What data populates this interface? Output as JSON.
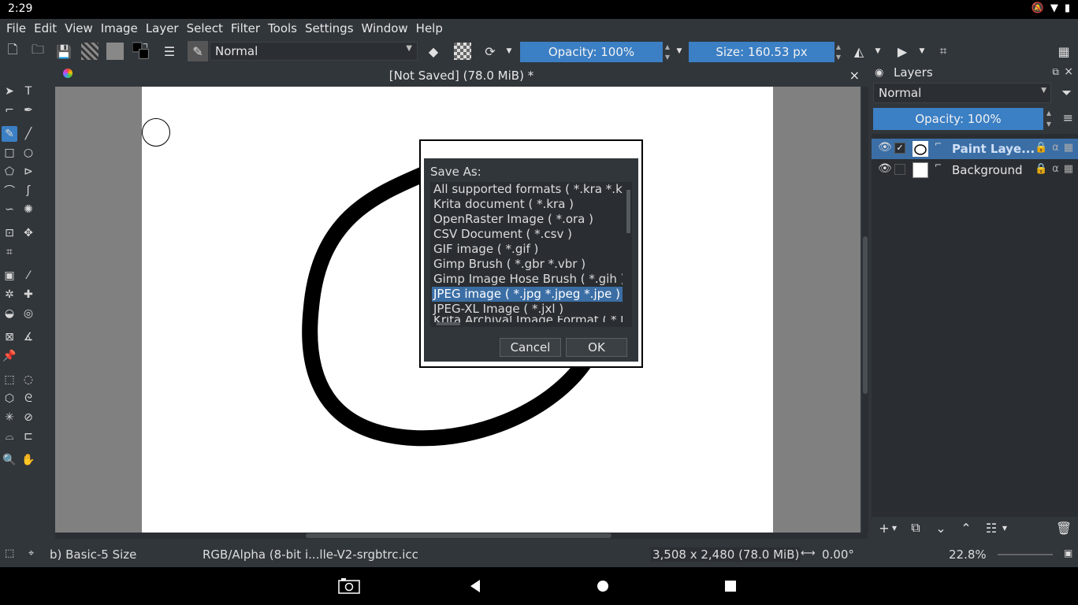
{
  "status": {
    "time": "2:29",
    "icons": [
      "mute-icon",
      "wifi-icon",
      "battery-icon"
    ]
  },
  "menu": [
    "File",
    "Edit",
    "View",
    "Image",
    "Layer",
    "Select",
    "Filter",
    "Tools",
    "Settings",
    "Window",
    "Help"
  ],
  "toolbar": {
    "blend_mode": "Normal",
    "opacity_label": "Opacity: 100%",
    "size_label": "Size: 160.53 px"
  },
  "document": {
    "title": "[Not Saved]  (78.0 MiB) *",
    "close": "×"
  },
  "dialog": {
    "label": "Save As:",
    "formats": [
      "All supported formats ( *.kra *.krz",
      "Krita document ( *.kra )",
      "OpenRaster Image ( *.ora )",
      "CSV Document ( *.csv )",
      "GIF image ( *.gif )",
      "Gimp Brush ( *.gbr *.vbr )",
      "Gimp Image Hose Brush ( *.gih )",
      "JPEG image ( *.jpg *.jpeg *.jpe )",
      "JPEG-XL Image ( *.jxl )",
      "Krita Archival Image Format ( *.krz"
    ],
    "selected_index": 7,
    "cancel": "Cancel",
    "ok": "OK"
  },
  "layers": {
    "title": "Layers",
    "blend_mode": "Normal",
    "opacity_label": "Opacity:  100%",
    "items": [
      {
        "name": "Paint Laye...",
        "selected": true,
        "checked": "✓"
      },
      {
        "name": "Background",
        "selected": false,
        "checked": ""
      }
    ]
  },
  "statusbar": {
    "brush": "b) Basic-5 Size",
    "color_profile": "RGB/Alpha (8-bit i...lle-V2-srgbtrc.icc",
    "dimensions": "3,508 x 2,480 (78.0 MiB)",
    "rotation": "0.00°",
    "zoom": "22.8%"
  },
  "colors": {
    "accent": "#3b7fc4",
    "selection": "#3b6ea5",
    "background": "#31363b"
  }
}
